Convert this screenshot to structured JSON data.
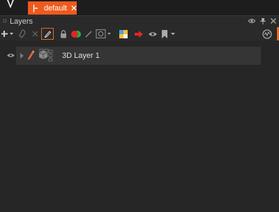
{
  "app": {
    "document_tab": {
      "label": "default",
      "accent": "#ee5a1c"
    }
  },
  "layers_panel": {
    "title": "Layers",
    "header_controls": [
      "eye-icon",
      "pin-icon",
      "close-icon"
    ],
    "toolbar": {
      "icons": [
        "add-menu-icon",
        "duplicate-icon",
        "delete-icon",
        "pencil-icon",
        "lock-icon",
        "color-tag-icon",
        "line-icon",
        "frame-menu-icon",
        "palette-icon",
        "arrow-icon",
        "visibility-icon",
        "bookmark-menu-icon",
        "settings-gauge-icon"
      ],
      "active_tool": "pencil-icon"
    },
    "layers": [
      {
        "name": "3D Layer 1",
        "visible": true,
        "type": "3d-layer"
      }
    ]
  }
}
